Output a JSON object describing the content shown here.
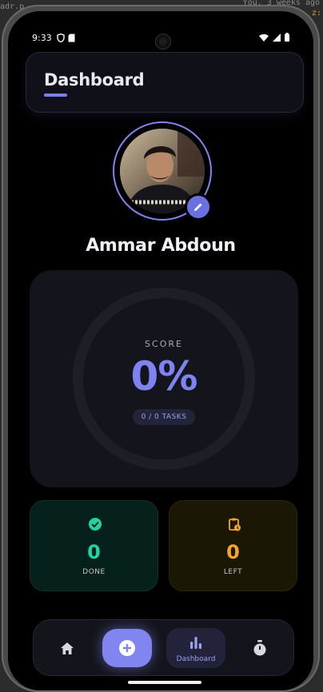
{
  "ide": {
    "left_text": "adr.p",
    "top_right_text": "You, 3 weeks ago",
    "right_text": "z:"
  },
  "status_bar": {
    "time": "9:33"
  },
  "header": {
    "title": "Dashboard"
  },
  "profile": {
    "name": "Ammar Abdoun"
  },
  "score": {
    "label": "SCORE",
    "value": "0%",
    "tasks": "0 / 0 TASKS"
  },
  "stats": {
    "done": {
      "value": "0",
      "label": "DONE",
      "color": "#22d3a3"
    },
    "left": {
      "value": "0",
      "label": "LEFT",
      "color": "#f4a627"
    }
  },
  "nav": {
    "items": [
      {
        "icon": "home-icon"
      },
      {
        "icon": "plus-circle-icon"
      },
      {
        "icon": "bar-chart-icon",
        "label": "Dashboard",
        "active": true
      },
      {
        "icon": "stopwatch-icon"
      }
    ]
  },
  "colors": {
    "accent": "#7f83f2",
    "background": "#000000",
    "card": "#14141c"
  }
}
